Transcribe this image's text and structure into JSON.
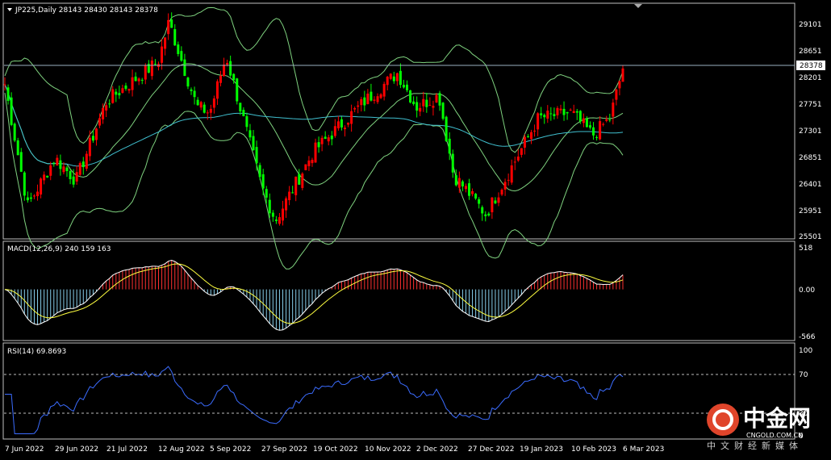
{
  "colors": {
    "background": "#000000",
    "frame": "#c0c0c0",
    "bull": "#ff0000",
    "bear": "#00ff00",
    "bollinger": "#7fd27f",
    "ma": "#40c0d0",
    "macd_pos": "#ff3030",
    "macd_neg": "#87ceeb",
    "macd_line": "#ffffff",
    "signal_line": "#ffff40",
    "rsi_line": "#3b6cff",
    "price_line": "#9ab0c0"
  },
  "main_panel": {
    "header": "JP225,Daily  28143 28430 28143 28378",
    "price_tag": "28378",
    "yticks": [
      "29101",
      "28651",
      "28201",
      "27751",
      "27301",
      "26851",
      "26401",
      "25951",
      "25501"
    ]
  },
  "macd_panel": {
    "header": "MACD(12,26,9) 240 159 163",
    "yticks": [
      "518",
      "0.00",
      "-566"
    ]
  },
  "rsi_panel": {
    "header": "RSI(14) 69.8693",
    "yticks": [
      "100",
      "70",
      "30",
      "0"
    ]
  },
  "xaxis": {
    "labels": [
      "7 Jun 2022",
      "29 Jun 2022",
      "21 Jul 2022",
      "12 Aug 2022",
      "5 Sep 2022",
      "27 Sep 2022",
      "19 Oct 2022",
      "10 Nov 2022",
      "2 Dec 2022",
      "27 Dec 2022",
      "19 Jan 2023",
      "10 Feb 2023",
      "6 Mar 2023"
    ]
  },
  "watermark": {
    "brand": "中金网",
    "domain": "CNGOLD.COM.CN",
    "tagline": "中文财经新媒体"
  },
  "chart_data": {
    "type": "candlestick",
    "symbol": "JP225",
    "timeframe": "Daily",
    "last_bar": {
      "open": 28143,
      "high": 28430,
      "low": 28143,
      "close": 28378
    },
    "price_ylim": [
      25400,
      29500
    ],
    "anchors": [
      {
        "date": "7 Jun 2022",
        "close": 28100
      },
      {
        "date": "17 Jun 2022",
        "close": 25950
      },
      {
        "date": "29 Jun 2022",
        "close": 26800
      },
      {
        "date": "8 Jul 2022",
        "close": 26400
      },
      {
        "date": "21 Jul 2022",
        "close": 27800
      },
      {
        "date": "12 Aug 2022",
        "close": 28500
      },
      {
        "date": "17 Aug 2022",
        "close": 29200
      },
      {
        "date": "30 Aug 2022",
        "close": 27700
      },
      {
        "date": "5 Sep 2022",
        "close": 27600
      },
      {
        "date": "12 Sep 2022",
        "close": 28600
      },
      {
        "date": "27 Sep 2022",
        "close": 26300
      },
      {
        "date": "3 Oct 2022",
        "close": 25700
      },
      {
        "date": "19 Oct 2022",
        "close": 26900
      },
      {
        "date": "10 Nov 2022",
        "close": 27800
      },
      {
        "date": "24 Nov 2022",
        "close": 28300
      },
      {
        "date": "2 Dec 2022",
        "close": 27700
      },
      {
        "date": "13 Dec 2022",
        "close": 27900
      },
      {
        "date": "20 Dec 2022",
        "close": 26500
      },
      {
        "date": "27 Dec 2022",
        "close": 26200
      },
      {
        "date": "4 Jan 2023",
        "close": 25800
      },
      {
        "date": "19 Jan 2023",
        "close": 26900
      },
      {
        "date": "27 Jan 2023",
        "close": 27500
      },
      {
        "date": "10 Feb 2023",
        "close": 27600
      },
      {
        "date": "20 Feb 2023",
        "close": 27200
      },
      {
        "date": "28 Feb 2023",
        "close": 27500
      },
      {
        "date": "6 Mar 2023",
        "close": 28378
      }
    ],
    "indicators": {
      "bollinger": "Bollinger Bands",
      "moving_average": "Moving Average",
      "macd": {
        "params": "12,26,9",
        "values": [
          240,
          159,
          163
        ],
        "ylim": [
          -566,
          518
        ]
      },
      "rsi": {
        "period": 14,
        "value": 69.8693,
        "levels": [
          70,
          30
        ],
        "ylim": [
          0,
          100
        ]
      }
    }
  }
}
